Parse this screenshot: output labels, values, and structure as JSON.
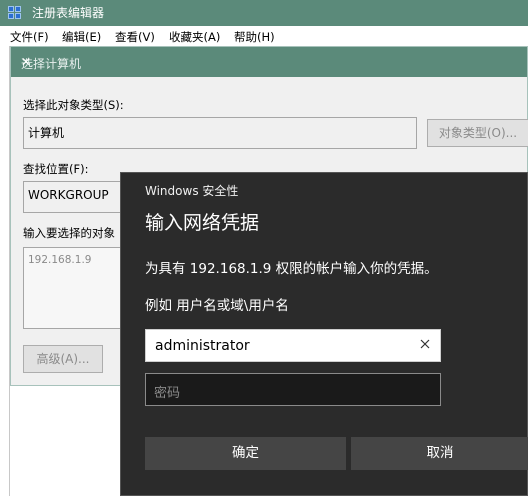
{
  "regedit": {
    "title": "注册表编辑器",
    "menu": [
      "文件(F)",
      "编辑(E)",
      "查看(V)",
      "收藏夹(A)",
      "帮助(H)"
    ]
  },
  "select_computer": {
    "title": "选择计算机",
    "object_type_label": "选择此对象类型(S):",
    "object_type_value": "计算机",
    "object_type_button": "对象类型(O)...",
    "location_label": "查找位置(F):",
    "location_value": "WORKGROUP",
    "enter_names_label": "输入要选择的对象",
    "entered_name": "192.168.1.9",
    "advanced_button": "高级(A)..."
  },
  "credentials": {
    "app_title": "Windows 安全性",
    "heading": "输入网络凭据",
    "description": "为具有 192.168.1.9 权限的帐户输入你的凭据。",
    "example": "例如 用户名或域\\用户名",
    "username": "administrator",
    "password_placeholder": "密码",
    "ok_label": "确定",
    "cancel_label": "取消"
  }
}
